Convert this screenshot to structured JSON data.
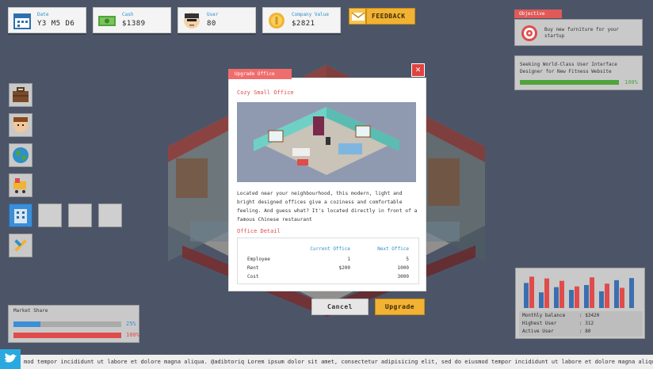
{
  "top_bar": {
    "date": {
      "label": "Date",
      "value": "Y3 M5 D6"
    },
    "cash": {
      "label": "Cash",
      "value": "$1389"
    },
    "user": {
      "label": "User",
      "value": "80"
    },
    "company_value": {
      "label": "Company Value",
      "value": "$2821"
    },
    "feedback_label": "FEEDBACK"
  },
  "objective": {
    "tag": "Objective",
    "items": [
      {
        "text": "Buy new furniture for your startup"
      },
      {
        "text": "Seeking World-Class User Interface Designer for New Fitness Website",
        "progress_label": "100%",
        "progress": 1.0
      }
    ]
  },
  "market_share": {
    "title": "Market Share",
    "bars": [
      {
        "label": "25%",
        "fraction": 0.25,
        "color": "#3b8fd6"
      },
      {
        "label": "100%",
        "fraction": 1.0,
        "color": "#e04b4b"
      }
    ]
  },
  "finance": {
    "rows": [
      {
        "label": "Monthly balance",
        "value": ": $3420"
      },
      {
        "label": "Highest User",
        "value": ": 312"
      },
      {
        "label": "Active User",
        "value": ": 80"
      }
    ],
    "chart_bars": [
      {
        "blue": 0.72,
        "red": 0.9
      },
      {
        "blue": 0.45,
        "red": 0.85
      },
      {
        "blue": 0.6,
        "red": 0.78
      },
      {
        "blue": 0.52,
        "red": 0.62
      },
      {
        "blue": 0.66,
        "red": 0.88
      },
      {
        "blue": 0.48,
        "red": 0.7
      },
      {
        "blue": 0.8,
        "red": 0.58
      },
      {
        "blue": 0.86,
        "red": 0.0
      }
    ]
  },
  "modal": {
    "title": "Upgrade Office",
    "office_name": "Cozy Small Office",
    "description": "Located near your neighbourhood, this modern, light and bright designed offices give a coziness and comfortable feeling. And guess what? It's located directly in front of a famous Chinese restaurant",
    "detail_title": "Office Detail",
    "detail_headers": {
      "current": "Current Office",
      "next": "Next Office"
    },
    "detail_rows": [
      {
        "label": "Employee",
        "current": "1",
        "next": "5"
      },
      {
        "label": "Rent",
        "current": "$200",
        "next": "1000"
      },
      {
        "label": "Cost",
        "current": "",
        "next": "3000"
      }
    ],
    "cancel_label": "Cancel",
    "upgrade_label": "Upgrade"
  },
  "ticker": {
    "text": "mod tempor incididunt ut labore et dolore magna aliqua.   @adibtoriq Lorem ipsum dolor sit amet, consectetur adipisicing elit, sed do eiusmod tempor incididunt ut labore et dolore magna aliqua."
  },
  "colors": {
    "accent_red": "#e04b4b",
    "accent_blue": "#2f8fc8",
    "button_yellow": "#f2b233",
    "twitter": "#2aa9e0"
  }
}
